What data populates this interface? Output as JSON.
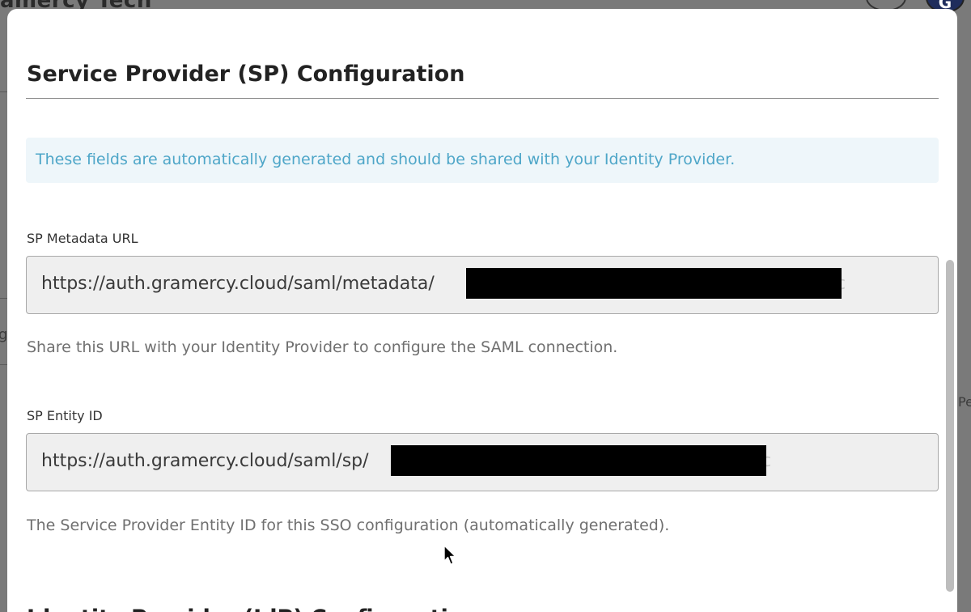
{
  "background": {
    "app_title": "amercy Tech",
    "avatar_initial": "G",
    "edge_chars": [
      "g",
      "Pe"
    ]
  },
  "modal": {
    "title": "Service Provider (SP) Configuration",
    "info_message": "These fields are automatically generated and should be shared with your Identity Provider.",
    "metadata_url": {
      "label": "SP Metadata URL",
      "value": "https://auth.gramercy.cloud/saml/metadata/",
      "tail": "c",
      "help": "Share this URL with your Identity Provider to configure the SAML connection."
    },
    "entity_id": {
      "label": "SP Entity ID",
      "value": "https://auth.gramercy.cloud/saml/sp/",
      "tail": "c",
      "help": "The Service Provider Entity ID for this SSO configuration (automatically generated)."
    },
    "next_section_title": "Identity Provider (IdP) Configuration"
  },
  "colors": {
    "info_bg": "#eef6fa",
    "info_text": "#4ea6c8",
    "field_bg": "#efefef",
    "overlay": "#7a7a7a"
  },
  "icons": [
    "bell-icon",
    "cursor-pointer-icon"
  ]
}
